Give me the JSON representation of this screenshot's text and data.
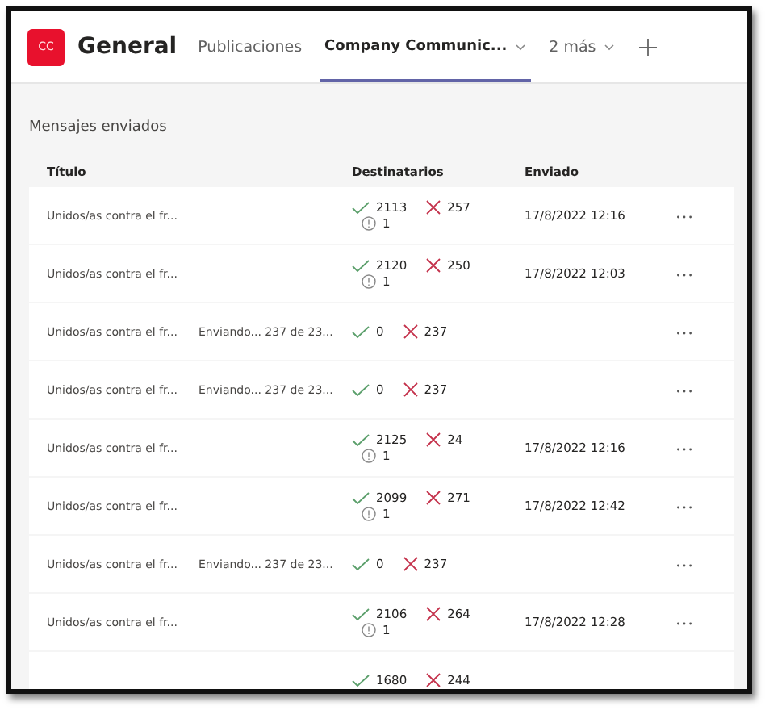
{
  "header": {
    "team_logo": "CC",
    "channel": "General",
    "tabs": [
      {
        "label": "Publicaciones",
        "selected": false,
        "dropdown": false
      },
      {
        "label": "Company Communic...",
        "selected": true,
        "dropdown": true
      },
      {
        "label": "2 más",
        "selected": false,
        "dropdown": true
      }
    ]
  },
  "section_title": "Mensajes enviados",
  "table": {
    "columns": [
      "Título",
      "Destinatarios",
      "Enviado"
    ],
    "rows": [
      {
        "title": "Unidos/as contra el fr...",
        "success": "2113",
        "failed": "257",
        "unknown": "1",
        "sent": "17/8/2022 12:16"
      },
      {
        "title": "Unidos/as contra el fr...",
        "success": "2120",
        "failed": "250",
        "unknown": "1",
        "sent": "17/8/2022 12:03"
      },
      {
        "title": "Unidos/as contra el fr...",
        "status": "Enviando... 237 de 23...",
        "success": "0",
        "failed": "237"
      },
      {
        "title": "Unidos/as contra el fr...",
        "status": "Enviando... 237 de 23...",
        "success": "0",
        "failed": "237"
      },
      {
        "title": "Unidos/as contra el fr...",
        "success": "2125",
        "failed": "24",
        "unknown": "1",
        "sent": "17/8/2022 12:16"
      },
      {
        "title": "Unidos/as contra el fr...",
        "success": "2099",
        "failed": "271",
        "unknown": "1",
        "sent": "17/8/2022 12:42"
      },
      {
        "title": "Unidos/as contra el fr...",
        "status": "Enviando... 237 de 23...",
        "success": "0",
        "failed": "237"
      },
      {
        "title": "Unidos/as contra el fr...",
        "success": "2106",
        "failed": "264",
        "unknown": "1",
        "sent": "17/8/2022 12:28"
      },
      {
        "success": "1680",
        "failed": "244"
      }
    ]
  }
}
